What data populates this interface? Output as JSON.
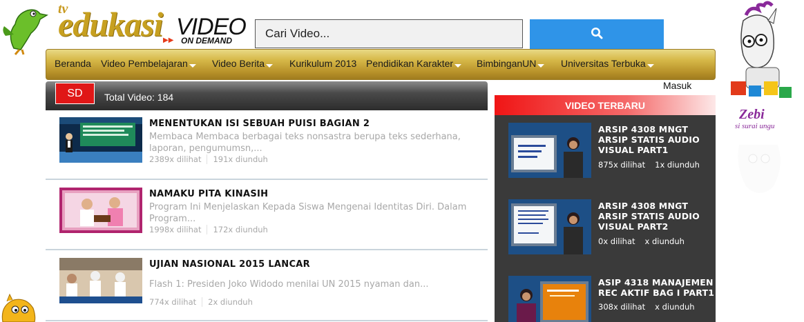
{
  "logo": {
    "tv": "tv",
    "edukasi": "edukasi",
    "video": "VIDEO",
    "on_demand": "ON DEMAND"
  },
  "search": {
    "placeholder": "Cari Video...",
    "button_icon": "search-icon"
  },
  "nav": {
    "items": [
      {
        "label": "Beranda",
        "dropdown": false
      },
      {
        "label": "Video Pembelajaran",
        "dropdown": true
      },
      {
        "label": "Video Berita",
        "dropdown": true
      },
      {
        "label": "Kurikulum 2013",
        "dropdown": false
      },
      {
        "label": "Pendidikan Karakter",
        "dropdown": true
      },
      {
        "label": "BimbinganUN",
        "dropdown": true
      },
      {
        "label": "Universitas Terbuka",
        "dropdown": true
      }
    ],
    "login": "Masuk"
  },
  "list": {
    "level_badge": "SD",
    "total_label": "Total Video: 184",
    "videos": [
      {
        "title": "MENENTUKAN ISI SEBUAH PUISI BAGIAN 2",
        "desc": "Membaca Membaca berbagai teks nonsastra berupa teks sederhana, laporan, pengumumsn,...",
        "views": "2389x dilihat",
        "downloads": "191x diunduh"
      },
      {
        "title": "NAMAKU PITA KINASIH",
        "desc": "Program Ini Menjelaskan Kepada Siswa Mengenai Identitas Diri. Dalam Program...",
        "views": "1998x dilihat",
        "downloads": "172x diunduh"
      },
      {
        "title": "UJIAN NASIONAL 2015 LANCAR",
        "desc": "Flash 1: Presiden Joko Widodo menilai UN 2015 nyaman dan...",
        "views": "774x dilihat",
        "downloads": "2x diunduh"
      }
    ]
  },
  "latest": {
    "header": "VIDEO TERBARU",
    "videos": [
      {
        "title": "ARSIP 4308 MNGT ARSIP STATIS AUDIO VISUAL PART1",
        "views": "875x dilihat",
        "downloads": "1x diunduh"
      },
      {
        "title": "ARSIP 4308 MNGT ARSIP STATIS AUDIO VISUAL PART2",
        "views": "0x dilihat",
        "downloads": "x diunduh"
      },
      {
        "title": "ASIP 4318 MANAJEMEN REC AKTIF BAG I PART1",
        "views": "308x dilihat",
        "downloads": "x diunduh"
      }
    ]
  },
  "mascot": {
    "name": "Zebi",
    "tagline": "si surai ungu"
  },
  "colors": {
    "accent_blue": "#2f94e8",
    "badge_red": "#e01717",
    "nav_gold": "#d6b848",
    "panel_dark": "#3a3a3a"
  }
}
